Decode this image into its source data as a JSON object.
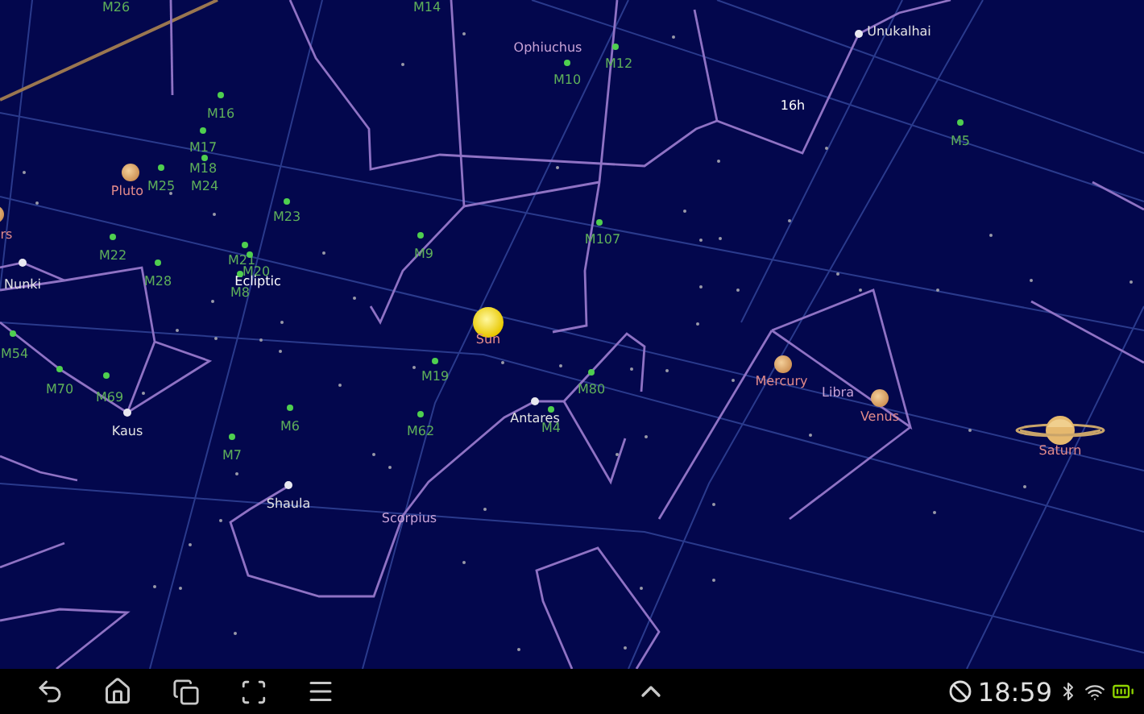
{
  "sky": {
    "objects": [
      {
        "kind": "cluster",
        "label": "M26"
      },
      {
        "kind": "cluster",
        "label": "M14"
      },
      {
        "kind": "constellation",
        "label": "Ophiuchus"
      },
      {
        "kind": "cluster",
        "label": "M10"
      },
      {
        "kind": "cluster",
        "label": "M12"
      },
      {
        "kind": "star",
        "label": "Unukalhai"
      },
      {
        "kind": "cluster",
        "label": "M16"
      },
      {
        "kind": "grid-label",
        "label": "16h"
      },
      {
        "kind": "cluster",
        "label": "M5"
      },
      {
        "kind": "cluster",
        "label": "M17"
      },
      {
        "kind": "cluster",
        "label": "M18"
      },
      {
        "kind": "planet",
        "label": "Pluto"
      },
      {
        "kind": "cluster",
        "label": "M25"
      },
      {
        "kind": "cluster",
        "label": "M24"
      },
      {
        "kind": "cluster",
        "label": "M23"
      },
      {
        "kind": "planet",
        "label": "rs"
      },
      {
        "kind": "cluster",
        "label": "M22"
      },
      {
        "kind": "cluster",
        "label": "M21"
      },
      {
        "kind": "cluster",
        "label": "M9"
      },
      {
        "kind": "cluster",
        "label": "M107"
      },
      {
        "kind": "cluster",
        "label": "M20"
      },
      {
        "kind": "star",
        "label": "Nunki"
      },
      {
        "kind": "cluster",
        "label": "M28"
      },
      {
        "kind": "ecliptic-label",
        "label": "Ecliptic"
      },
      {
        "kind": "cluster",
        "label": "M8"
      },
      {
        "kind": "sun",
        "label": "Sun"
      },
      {
        "kind": "cluster",
        "label": "M54"
      },
      {
        "kind": "cluster",
        "label": "M70"
      },
      {
        "kind": "cluster",
        "label": "M69"
      },
      {
        "kind": "cluster",
        "label": "M19"
      },
      {
        "kind": "cluster",
        "label": "M80"
      },
      {
        "kind": "planet",
        "label": "Mercury"
      },
      {
        "kind": "constellation",
        "label": "Libra"
      },
      {
        "kind": "star",
        "label": "Kaus"
      },
      {
        "kind": "cluster",
        "label": "M6"
      },
      {
        "kind": "cluster",
        "label": "M62"
      },
      {
        "kind": "star",
        "label": "Antares"
      },
      {
        "kind": "cluster",
        "label": "M4"
      },
      {
        "kind": "planet",
        "label": "Venus"
      },
      {
        "kind": "ringed-planet",
        "label": "Saturn"
      },
      {
        "kind": "cluster",
        "label": "M7"
      },
      {
        "kind": "star",
        "label": "Shaula"
      },
      {
        "kind": "constellation",
        "label": "Scorpius"
      }
    ]
  },
  "status_bar": {
    "time": "18:59"
  }
}
